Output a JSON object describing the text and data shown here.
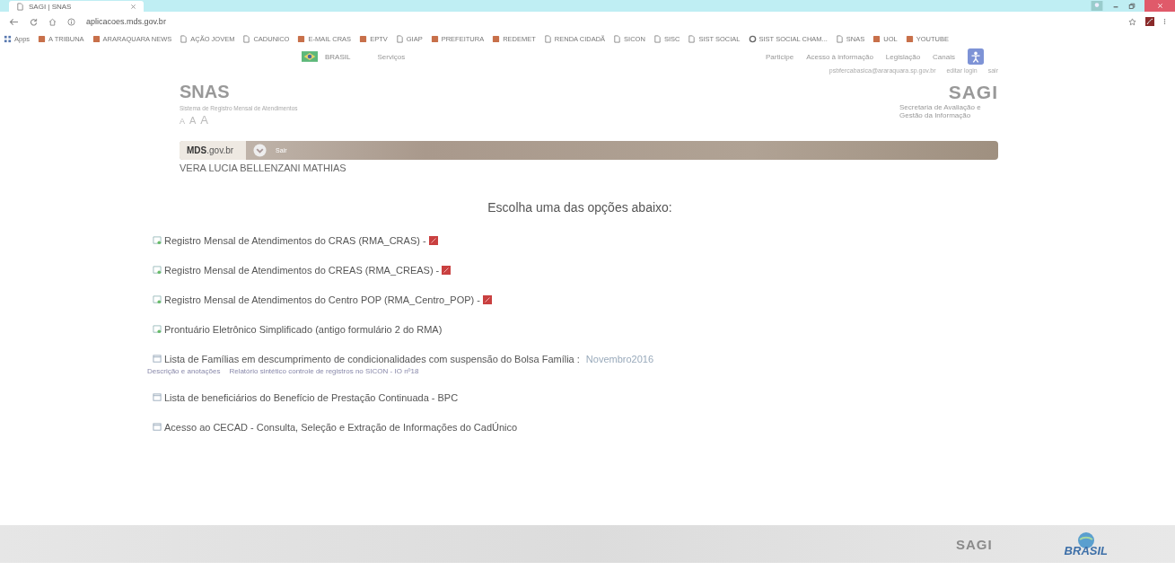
{
  "browser": {
    "tab_title": "SAGI | SNAS",
    "address": "aplicacoes.mds.gov.br",
    "bookmarks": [
      {
        "label": "Apps",
        "kind": "apps"
      },
      {
        "label": "A TRIBUNA",
        "kind": "site"
      },
      {
        "label": "ARARAQUARA NEWS",
        "kind": "site"
      },
      {
        "label": "AÇÃO JOVEM",
        "kind": "page"
      },
      {
        "label": "CADUNICO",
        "kind": "page"
      },
      {
        "label": "E-MAIL CRAS",
        "kind": "site"
      },
      {
        "label": "EPTV",
        "kind": "site"
      },
      {
        "label": "GIAP",
        "kind": "page"
      },
      {
        "label": "PREFEITURA",
        "kind": "site"
      },
      {
        "label": "REDEMET",
        "kind": "site"
      },
      {
        "label": "RENDA CIDADÃ",
        "kind": "page"
      },
      {
        "label": "SICON",
        "kind": "page"
      },
      {
        "label": "SISC",
        "kind": "page"
      },
      {
        "label": "SIST SOCIAL",
        "kind": "page"
      },
      {
        "label": "SIST SOCIAL CHAM...",
        "kind": "google"
      },
      {
        "label": "SNAS",
        "kind": "page"
      },
      {
        "label": "UOL",
        "kind": "site"
      },
      {
        "label": "YOUTUBE",
        "kind": "site"
      }
    ]
  },
  "gov_bar": {
    "brand": "BRASIL",
    "services": "Serviços",
    "links": [
      "Participe",
      "Acesso à informação",
      "Legislação",
      "Canais"
    ]
  },
  "account": {
    "email": "psbfercabasica@araraquara.sp.gov.br",
    "edit": "editar login",
    "logout": "sair"
  },
  "header": {
    "title": "SNAS",
    "subtitle": "Sistema de Registro Mensal de Atendimentos",
    "font_sizes": [
      "A",
      "A",
      "A"
    ],
    "logo": "SAGI",
    "logo_caption": "Secretaria de Avaliação e Gestão da Informação"
  },
  "menu_bar": {
    "home": "MDS.gov.br",
    "exit": "Sair"
  },
  "user_name": "VERA LUCIA BELLENZANI MATHIAS",
  "heading": "Escolha uma das opções abaixo:",
  "options": [
    {
      "kind": "form",
      "text": "Registro Mensal de Atendimentos do CRAS (RMA_CRAS) -",
      "pdf": true
    },
    {
      "kind": "form",
      "text": "Registro Mensal de Atendimentos do CREAS (RMA_CREAS) -",
      "pdf": true
    },
    {
      "kind": "form",
      "text": "Registro Mensal de Atendimentos do Centro POP (RMA_Centro_POP) -",
      "pdf": true
    },
    {
      "kind": "form",
      "text": "Prontuário Eletrônico Simplificado (antigo formulário 2 do RMA)",
      "pdf": false
    },
    {
      "kind": "window",
      "text": "Lista de Famílias em descumprimento de condicionalidades com suspensão do Bolsa Família :",
      "pdf": false,
      "period": "Novembro2016",
      "notes": [
        "Descrição e anotações",
        "Relatório sintético controle de registros no SICON - IO nº18"
      ]
    },
    {
      "kind": "window",
      "text": "Lista de beneficiários do Benefício de Prestação Continuada - BPC",
      "pdf": false
    },
    {
      "kind": "window",
      "text": "Acesso ao CECAD - Consulta, Seleção e Extração de Informações do CadÚnico",
      "pdf": false
    }
  ],
  "footer": {
    "logo": "SAGI",
    "emblem": "BRASIL"
  }
}
